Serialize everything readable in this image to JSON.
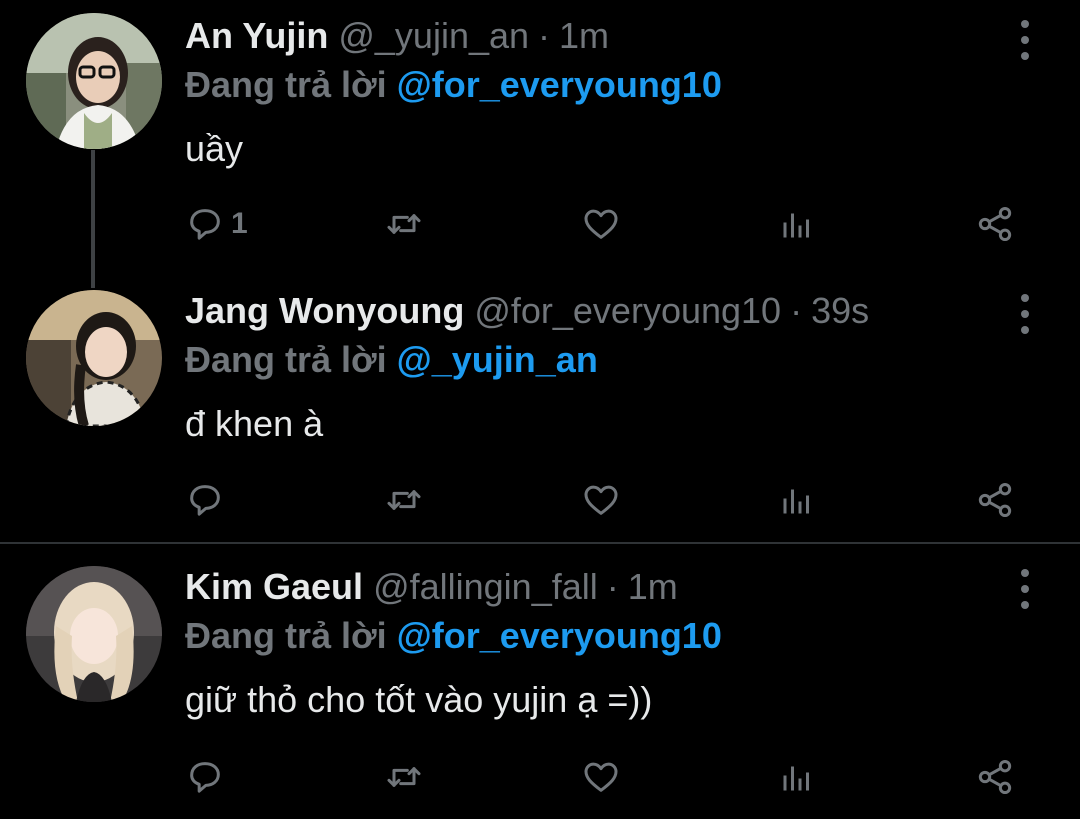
{
  "theme": {
    "background": "#000000",
    "text_primary": "#e7e9ea",
    "text_secondary": "#71767b",
    "accent": "#1d9bf0"
  },
  "tweets": [
    {
      "name": "An Yujin",
      "handle": "@_yujin_an",
      "dot": "·",
      "time": "1m",
      "replying_prefix": "Đang trả lời",
      "replying_to": "@for_everyoung10",
      "text": "uầy",
      "reply_count": "1",
      "avatar": "avatar-an-yujin",
      "icons": [
        "reply-icon",
        "retweet-icon",
        "like-icon",
        "views-icon",
        "share-icon",
        "more-icon"
      ]
    },
    {
      "name": "Jang Wonyoung",
      "handle": "@for_everyoung10",
      "dot": "·",
      "time": "39s",
      "replying_prefix": "Đang trả lời",
      "replying_to": "@_yujin_an",
      "text": "đ khen à",
      "reply_count": "",
      "avatar": "avatar-jang-wonyoung",
      "icons": [
        "reply-icon",
        "retweet-icon",
        "like-icon",
        "views-icon",
        "share-icon",
        "more-icon"
      ]
    },
    {
      "name": "Kim Gaeul",
      "handle": "@fallingin_fall",
      "dot": "·",
      "time": "1m",
      "replying_prefix": "Đang trả lời",
      "replying_to": "@for_everyoung10",
      "text": "giữ thỏ cho tốt vào yujin ạ =))",
      "reply_count": "",
      "avatar": "avatar-kim-gaeul",
      "icons": [
        "reply-icon",
        "retweet-icon",
        "like-icon",
        "views-icon",
        "share-icon",
        "more-icon"
      ]
    }
  ]
}
